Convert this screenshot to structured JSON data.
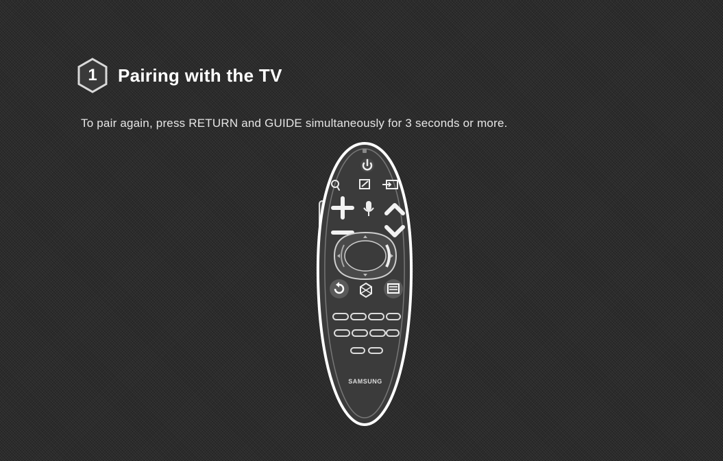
{
  "step": {
    "number": "1",
    "title": "Pairing with the TV"
  },
  "instruction": "To pair again, press RETURN and GUIDE simultaneously for 3 seconds or more.",
  "remote": {
    "brand": "SAMSUNG",
    "buttons": [
      "power-icon",
      "search-icon",
      "smart-hub-icon",
      "source-icon",
      "volume-up-icon",
      "microphone-icon",
      "channel-up-icon",
      "volume-down-icon",
      "channel-down-icon",
      "touchpad",
      "return-icon",
      "smart-hub-button",
      "guide-icon"
    ]
  },
  "colors": {
    "background": "#2b2b2b",
    "text": "#f2f2f2",
    "remote_body": "#3a3a3a",
    "remote_outline": "#ffffff"
  }
}
